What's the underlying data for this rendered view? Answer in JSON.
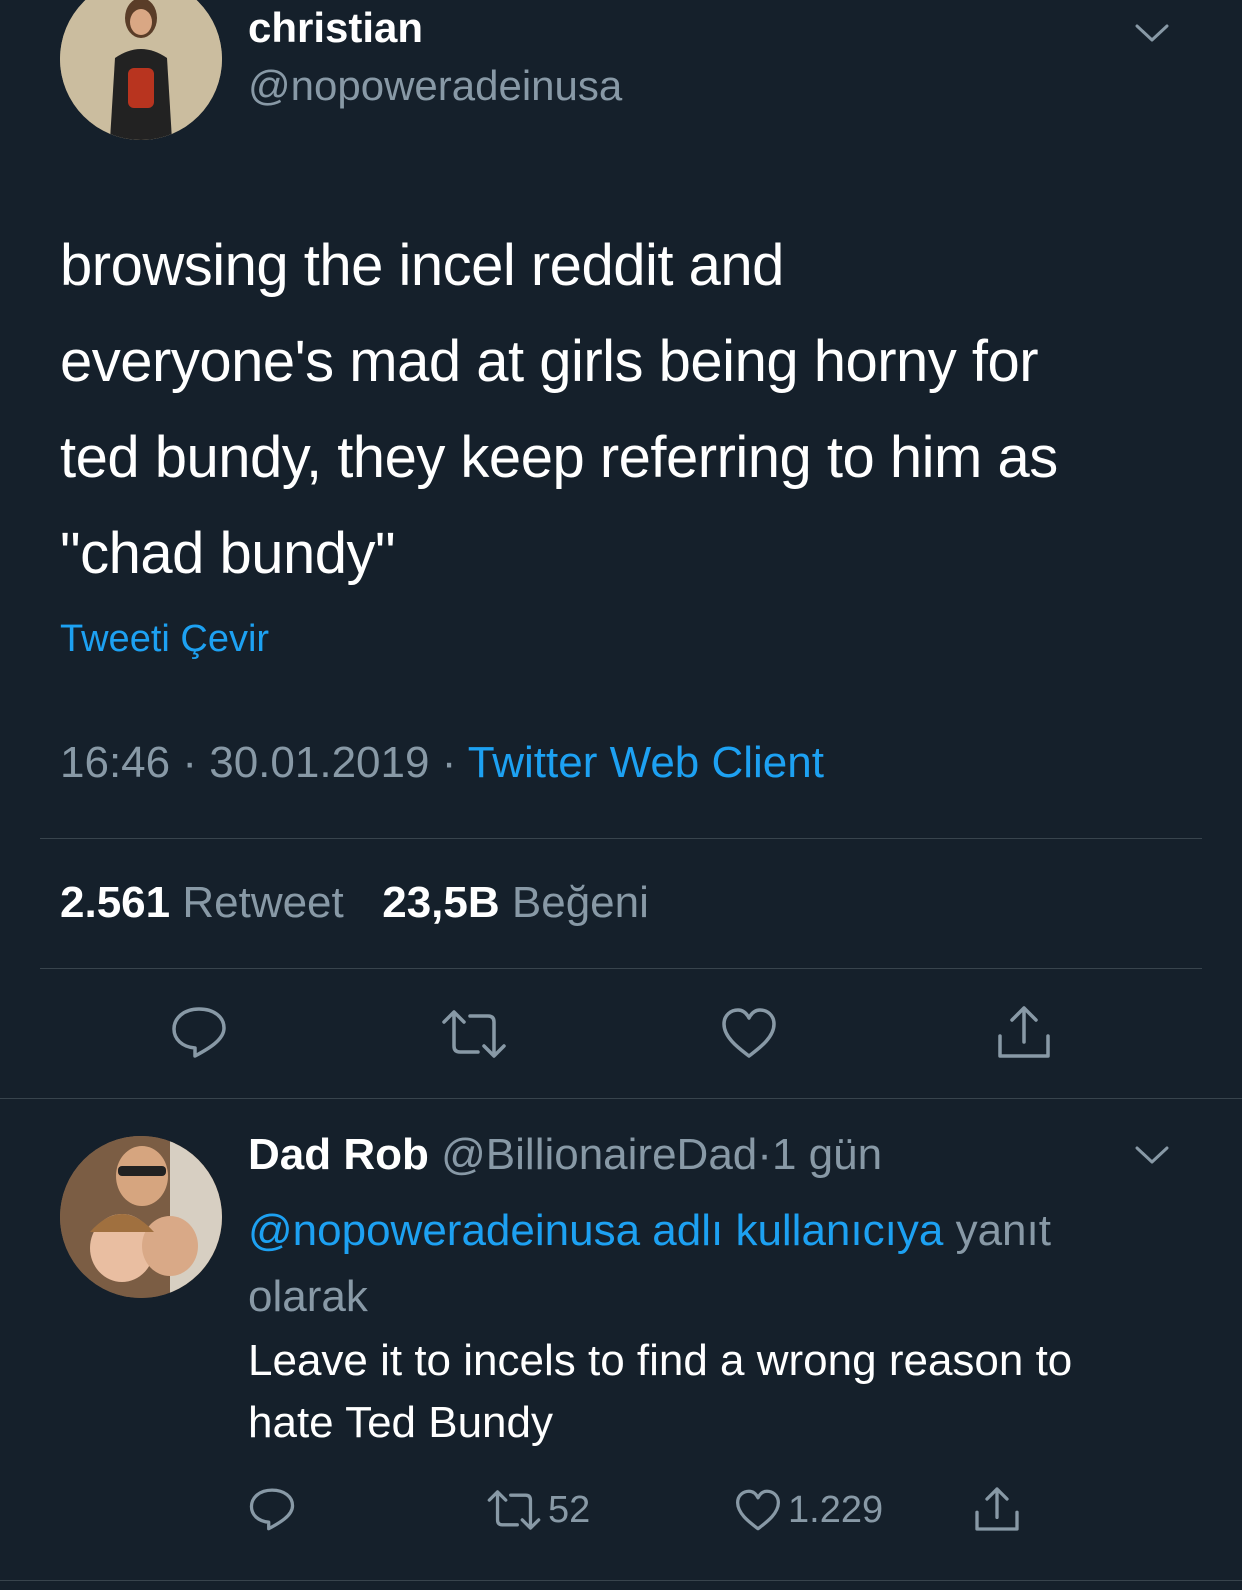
{
  "tweet": {
    "author_name": "christian",
    "author_handle": "@nopoweradeinusa",
    "text_lines": [
      "browsing the incel reddit and",
      "everyone's mad at girls being horny for",
      "ted bundy, they keep referring to him as",
      "\"chad bundy\""
    ],
    "translate_label": "Tweeti Çevir",
    "time": "16:46",
    "separator": "·",
    "date": "30.01.2019",
    "source": "Twitter Web Client",
    "retweet_count": "2.561",
    "retweet_label": "Retweet",
    "like_count": "23,5B",
    "like_label": "Beğeni"
  },
  "reply": {
    "author_name": "Dad Rob",
    "author_handle": "@BillionaireDad",
    "separator": "·",
    "age": "1 gün",
    "reply_to_link": "@nopoweradeinusa adlı kullanıcıya",
    "reply_to_suffix": "yanıt",
    "reply_to_suffix2": "olarak",
    "text_lines": [
      "Leave it to incels to find a wrong reason to",
      "hate Ted Bundy"
    ],
    "retweet_count": "52",
    "like_count": "1.229"
  },
  "icons": {
    "caret": "chevron-down-icon",
    "reply": "reply-icon",
    "retweet": "retweet-icon",
    "like": "heart-icon",
    "share": "share-icon"
  },
  "colors": {
    "background": "#15202b",
    "accent": "#1da1f2",
    "muted": "#8899a6",
    "divider": "#38444d"
  }
}
